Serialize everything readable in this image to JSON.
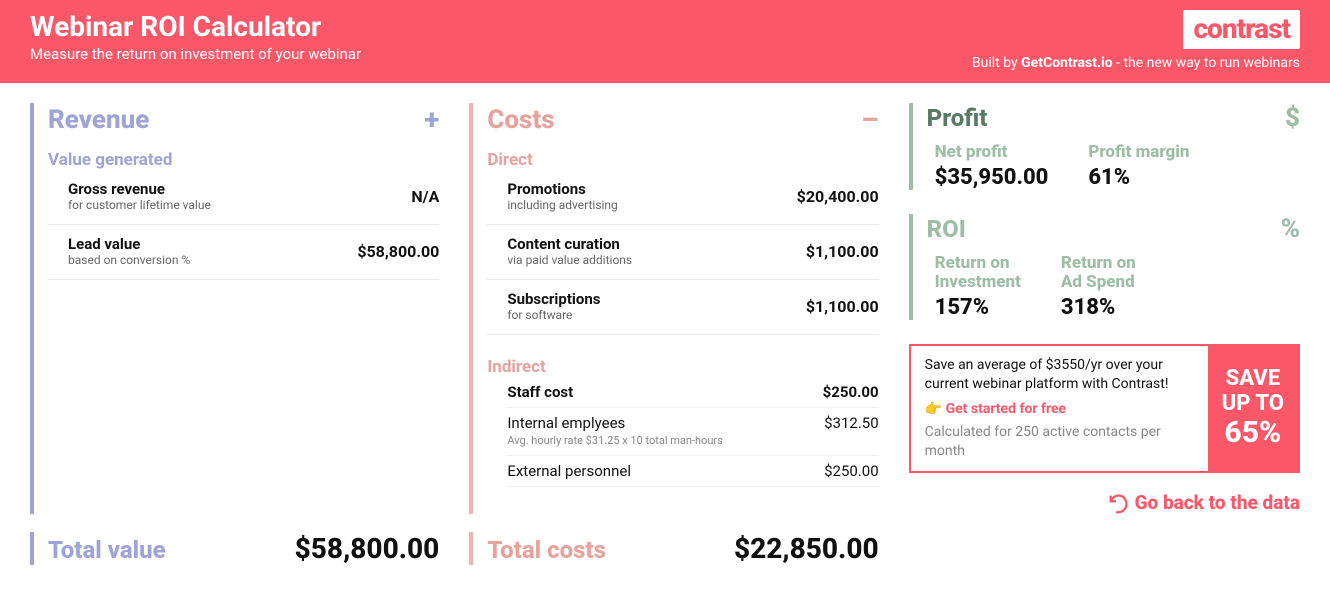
{
  "header": {
    "title": "Webinar ROI Calculator",
    "subtitle": "Measure the return on investment of your webinar",
    "logo": "contrast",
    "builtby_prefix": "Built by ",
    "builtby_brand": "GetContrast.io",
    "builtby_suffix": " - the new way to run webinars"
  },
  "revenue": {
    "heading": "Revenue",
    "icon": "+",
    "subheading": "Value generated",
    "items": [
      {
        "title": "Gross revenue",
        "sub": "for customer lifetime value",
        "value": "N/A"
      },
      {
        "title": "Lead value",
        "sub": "based on conversion %",
        "value": "$58,800.00"
      }
    ],
    "total_label": "Total value",
    "total_value": "$58,800.00"
  },
  "costs": {
    "heading": "Costs",
    "icon": "–",
    "direct_label": "Direct",
    "direct_items": [
      {
        "title": "Promotions",
        "sub": "including advertising",
        "value": "$20,400.00"
      },
      {
        "title": "Content curation",
        "sub": "via paid value additions",
        "value": "$1,100.00"
      },
      {
        "title": "Subscriptions",
        "sub": "for software",
        "value": "$1,100.00"
      }
    ],
    "indirect_label": "Indirect",
    "staff_cost_label": "Staff cost",
    "staff_cost_value": "$250.00",
    "internal_label": "Internal emplyees",
    "internal_value": "$312.50",
    "internal_note": "Avg. hourly rate $31.25 x 10 total man-hours",
    "external_label": "External personnel",
    "external_value": "$250.00",
    "total_label": "Total costs",
    "total_value": "$22,850.00"
  },
  "profit": {
    "heading": "Profit",
    "icon": "$",
    "net_label": "Net profit",
    "net_value": "$35,950.00",
    "margin_label": "Profit margin",
    "margin_value": "61%"
  },
  "roi": {
    "heading": "ROI",
    "icon": "%",
    "roi_label_l1": "Return on",
    "roi_label_l2": "Investment",
    "roi_value": "157%",
    "roas_label_l1": "Return on",
    "roas_label_l2": "Ad Spend",
    "roas_value": "318%"
  },
  "promo": {
    "text": "Save an average of $3550/yr over your current webinar platform with Contrast!",
    "cta_emoji": "👉",
    "cta_text": "Get started for free",
    "note": "Calculated for 250 active contacts per month",
    "big_l1": "SAVE",
    "big_l2": "UP TO",
    "big_l3": "65%"
  },
  "back_link": "Go back to the data"
}
